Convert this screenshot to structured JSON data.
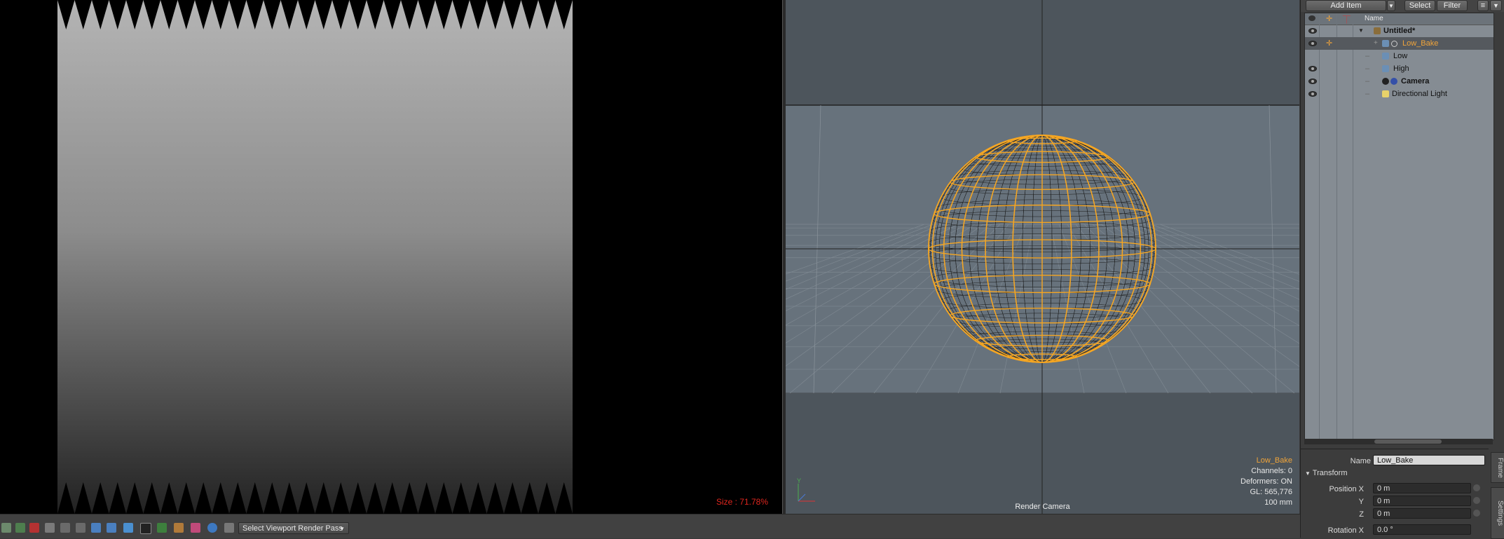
{
  "render_view": {
    "size_readout": "Size : 71.78%"
  },
  "viewport": {
    "selected_item": "Low_Bake",
    "channels": "Channels: 0",
    "deformers": "Deformers: ON",
    "gl": "GL: 565,776",
    "focal": "100 mm",
    "camera_label": "Render Camera",
    "axis_label": "Y",
    "wire_color": "#f5a623"
  },
  "toolbar": {
    "add_item": "Add Item",
    "select": "Select",
    "filter": "Filter"
  },
  "outliner": {
    "header_name": "Name",
    "items": [
      {
        "label": "Untitled*",
        "bold": true,
        "selected": false
      },
      {
        "label": "Low_Bake",
        "bold": false,
        "selected": true
      },
      {
        "label": "Low",
        "bold": false,
        "selected": false
      },
      {
        "label": "High",
        "bold": false,
        "selected": false
      },
      {
        "label": "Camera",
        "bold": true,
        "selected": false
      },
      {
        "label": "Directional Light",
        "bold": false,
        "selected": false
      }
    ]
  },
  "properties": {
    "name_label": "Name",
    "name_value": "Low_Bake",
    "section": "Transform",
    "position_x_label": "Position X",
    "position_x": "0 m",
    "y_label": "Y",
    "y_value": "0 m",
    "z_label": "Z",
    "z_value": "0 m",
    "rotation_x_label": "Rotation X",
    "rotation_x": "0.0 °",
    "tab_frame": "Frame",
    "tab_settings": "Settings"
  },
  "bottom_bar": {
    "render_pass": "Select Viewport Render Pass"
  }
}
